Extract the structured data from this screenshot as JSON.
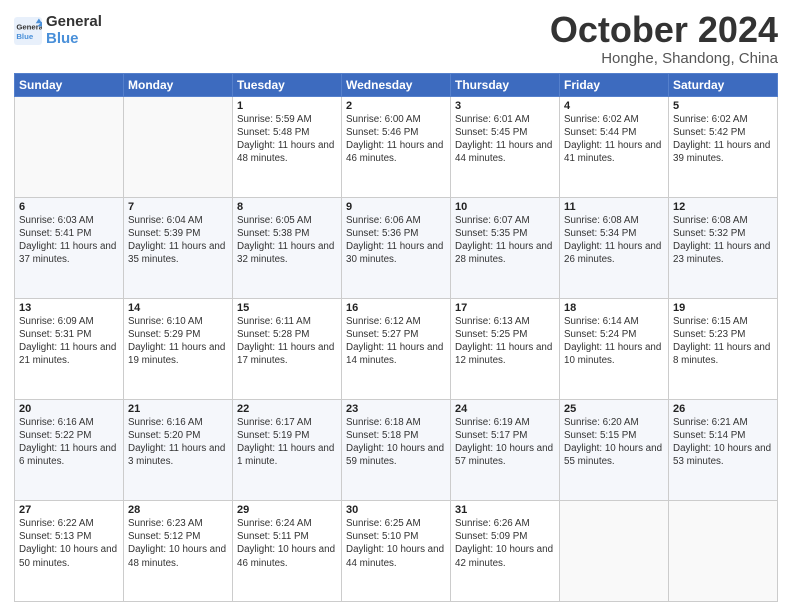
{
  "header": {
    "logo_line1": "General",
    "logo_line2": "Blue",
    "month": "October 2024",
    "location": "Honghe, Shandong, China"
  },
  "weekdays": [
    "Sunday",
    "Monday",
    "Tuesday",
    "Wednesday",
    "Thursday",
    "Friday",
    "Saturday"
  ],
  "rows": [
    [
      {
        "day": "",
        "info": ""
      },
      {
        "day": "",
        "info": ""
      },
      {
        "day": "1",
        "info": "Sunrise: 5:59 AM\nSunset: 5:48 PM\nDaylight: 11 hours and 48 minutes."
      },
      {
        "day": "2",
        "info": "Sunrise: 6:00 AM\nSunset: 5:46 PM\nDaylight: 11 hours and 46 minutes."
      },
      {
        "day": "3",
        "info": "Sunrise: 6:01 AM\nSunset: 5:45 PM\nDaylight: 11 hours and 44 minutes."
      },
      {
        "day": "4",
        "info": "Sunrise: 6:02 AM\nSunset: 5:44 PM\nDaylight: 11 hours and 41 minutes."
      },
      {
        "day": "5",
        "info": "Sunrise: 6:02 AM\nSunset: 5:42 PM\nDaylight: 11 hours and 39 minutes."
      }
    ],
    [
      {
        "day": "6",
        "info": "Sunrise: 6:03 AM\nSunset: 5:41 PM\nDaylight: 11 hours and 37 minutes."
      },
      {
        "day": "7",
        "info": "Sunrise: 6:04 AM\nSunset: 5:39 PM\nDaylight: 11 hours and 35 minutes."
      },
      {
        "day": "8",
        "info": "Sunrise: 6:05 AM\nSunset: 5:38 PM\nDaylight: 11 hours and 32 minutes."
      },
      {
        "day": "9",
        "info": "Sunrise: 6:06 AM\nSunset: 5:36 PM\nDaylight: 11 hours and 30 minutes."
      },
      {
        "day": "10",
        "info": "Sunrise: 6:07 AM\nSunset: 5:35 PM\nDaylight: 11 hours and 28 minutes."
      },
      {
        "day": "11",
        "info": "Sunrise: 6:08 AM\nSunset: 5:34 PM\nDaylight: 11 hours and 26 minutes."
      },
      {
        "day": "12",
        "info": "Sunrise: 6:08 AM\nSunset: 5:32 PM\nDaylight: 11 hours and 23 minutes."
      }
    ],
    [
      {
        "day": "13",
        "info": "Sunrise: 6:09 AM\nSunset: 5:31 PM\nDaylight: 11 hours and 21 minutes."
      },
      {
        "day": "14",
        "info": "Sunrise: 6:10 AM\nSunset: 5:29 PM\nDaylight: 11 hours and 19 minutes."
      },
      {
        "day": "15",
        "info": "Sunrise: 6:11 AM\nSunset: 5:28 PM\nDaylight: 11 hours and 17 minutes."
      },
      {
        "day": "16",
        "info": "Sunrise: 6:12 AM\nSunset: 5:27 PM\nDaylight: 11 hours and 14 minutes."
      },
      {
        "day": "17",
        "info": "Sunrise: 6:13 AM\nSunset: 5:25 PM\nDaylight: 11 hours and 12 minutes."
      },
      {
        "day": "18",
        "info": "Sunrise: 6:14 AM\nSunset: 5:24 PM\nDaylight: 11 hours and 10 minutes."
      },
      {
        "day": "19",
        "info": "Sunrise: 6:15 AM\nSunset: 5:23 PM\nDaylight: 11 hours and 8 minutes."
      }
    ],
    [
      {
        "day": "20",
        "info": "Sunrise: 6:16 AM\nSunset: 5:22 PM\nDaylight: 11 hours and 6 minutes."
      },
      {
        "day": "21",
        "info": "Sunrise: 6:16 AM\nSunset: 5:20 PM\nDaylight: 11 hours and 3 minutes."
      },
      {
        "day": "22",
        "info": "Sunrise: 6:17 AM\nSunset: 5:19 PM\nDaylight: 11 hours and 1 minute."
      },
      {
        "day": "23",
        "info": "Sunrise: 6:18 AM\nSunset: 5:18 PM\nDaylight: 10 hours and 59 minutes."
      },
      {
        "day": "24",
        "info": "Sunrise: 6:19 AM\nSunset: 5:17 PM\nDaylight: 10 hours and 57 minutes."
      },
      {
        "day": "25",
        "info": "Sunrise: 6:20 AM\nSunset: 5:15 PM\nDaylight: 10 hours and 55 minutes."
      },
      {
        "day": "26",
        "info": "Sunrise: 6:21 AM\nSunset: 5:14 PM\nDaylight: 10 hours and 53 minutes."
      }
    ],
    [
      {
        "day": "27",
        "info": "Sunrise: 6:22 AM\nSunset: 5:13 PM\nDaylight: 10 hours and 50 minutes."
      },
      {
        "day": "28",
        "info": "Sunrise: 6:23 AM\nSunset: 5:12 PM\nDaylight: 10 hours and 48 minutes."
      },
      {
        "day": "29",
        "info": "Sunrise: 6:24 AM\nSunset: 5:11 PM\nDaylight: 10 hours and 46 minutes."
      },
      {
        "day": "30",
        "info": "Sunrise: 6:25 AM\nSunset: 5:10 PM\nDaylight: 10 hours and 44 minutes."
      },
      {
        "day": "31",
        "info": "Sunrise: 6:26 AM\nSunset: 5:09 PM\nDaylight: 10 hours and 42 minutes."
      },
      {
        "day": "",
        "info": ""
      },
      {
        "day": "",
        "info": ""
      }
    ]
  ]
}
